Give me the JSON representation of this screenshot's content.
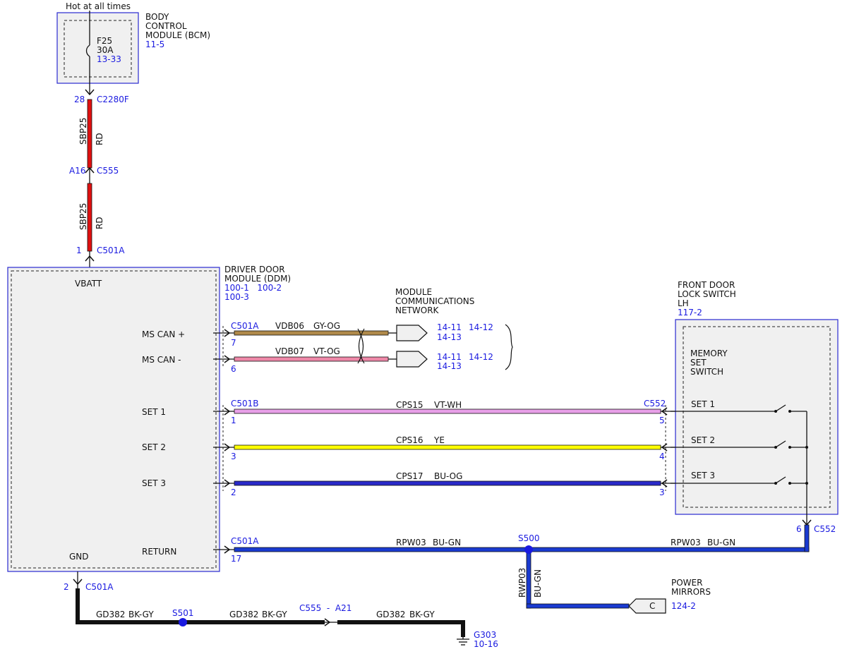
{
  "hot_label": "Hot at all times",
  "bcm": {
    "name_lines": [
      "BODY",
      "CONTROL",
      "MODULE (BCM)"
    ],
    "ref": "11-5",
    "fuse": "F25",
    "fuse_rating": "30A",
    "fuse_ref": "13-33"
  },
  "feed": {
    "seg1": {
      "pin_top": "28",
      "conn_top": "C2280F",
      "circuit": "SBP25",
      "color": "RD"
    },
    "mid": {
      "pin": "A16",
      "conn": "C555"
    },
    "seg2": {
      "circuit": "SBP25",
      "color": "RD",
      "pin_bottom": "1",
      "conn_bottom": "C501A"
    }
  },
  "ddm": {
    "name_lines": [
      "DRIVER DOOR",
      "MODULE (DDM)"
    ],
    "refs": "100-1   100-2",
    "ref3": "100-3",
    "vbatt": "VBATT",
    "gnd": "GND"
  },
  "mcn": {
    "lines": [
      "MODULE",
      "COMMUNICATIONS",
      "NETWORK"
    ]
  },
  "rows": [
    {
      "label": "MS CAN +",
      "conn": "C501A",
      "pin": "7",
      "circuit": "VDB06",
      "color": "GY-OG",
      "ref1": "14-11",
      "ref2": "14-12",
      "ref3": "14-13"
    },
    {
      "label": "MS CAN -",
      "pin": "6",
      "circuit": "VDB07",
      "color": "VT-OG",
      "ref1": "14-11",
      "ref2": "14-12",
      "ref3": "14-13"
    },
    {
      "label": "SET 1",
      "conn": "C501B",
      "pin": "1",
      "circuit": "CPS15",
      "color": "VT-WH",
      "far_conn": "C552",
      "far_pin": "5",
      "sw_label": "SET 1"
    },
    {
      "label": "SET 2",
      "pin": "3",
      "circuit": "CPS16",
      "color": "YE",
      "far_pin": "4",
      "sw_label": "SET 2"
    },
    {
      "label": "SET 3",
      "pin": "2",
      "circuit": "CPS17",
      "color": "BU-OG",
      "far_pin": "3",
      "sw_label": "SET 3"
    }
  ],
  "fdls": {
    "name_lines": [
      "FRONT DOOR",
      "LOCK SWITCH",
      "LH"
    ],
    "ref": "117-2",
    "inner_lines": [
      "MEMORY",
      "SET",
      "SWITCH"
    ]
  },
  "return_row": {
    "label": "RETURN",
    "conn": "C501A",
    "pin": "17",
    "circuit": "RPW03",
    "color": "BU-GN",
    "splice": "S500",
    "circuit_right": "RPW03",
    "color_right": "BU-GN",
    "far_pin": "6",
    "far_conn": "C552"
  },
  "branch": {
    "circuit": "RWP03",
    "color": "BU-GN",
    "connector_letter": "C",
    "dest_lines": [
      "POWER",
      "MIRRORS"
    ],
    "dest_ref": "124-2"
  },
  "ground": {
    "pin": "2",
    "conn": "C501A",
    "seg1_circuit": "GD382",
    "seg1_color": "BK-GY",
    "splice": "S501",
    "seg2_circuit": "GD382",
    "seg2_color": "BK-GY",
    "inline_conn": "C555  -  A21",
    "seg3_circuit": "GD382",
    "seg3_color": "BK-GY",
    "gnd_name": "G303",
    "gnd_ref": "10-16"
  },
  "colors": {
    "label_blue": "#1a1ae0",
    "rd": "#e01010",
    "gy_og": "#b08a4a",
    "vt_og": "#ee88a8",
    "vt_wh": "#e8a0e8",
    "ye": "#ffff00",
    "bu_og": "#2a2ac8",
    "bu_gn": "#1a3ad0",
    "bk": "#111111"
  }
}
